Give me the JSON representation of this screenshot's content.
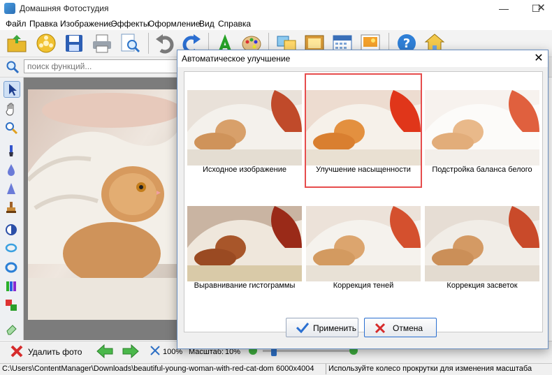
{
  "window": {
    "title": "Домашняя Фотостудия"
  },
  "menu": [
    "Файл",
    "Правка",
    "Изображение",
    "Эффекты",
    "Оформление",
    "Вид",
    "Справка"
  ],
  "search": {
    "placeholder": "поиск функций..."
  },
  "bottom": {
    "delete_label": "Удалить фото",
    "zoom_label": "100%",
    "scale_label": "Масштаб:",
    "scale_value": "10%",
    "zoom_level": 0.1
  },
  "status": {
    "path": "C:\\Users\\ContentManager\\Downloads\\beautiful-young-woman-with-red-cat-domestic-ca",
    "dims": "6000x4004",
    "hint": "Используйте колесо прокрутки для изменения масштаба"
  },
  "dialog": {
    "title": "Автоматическое улучшение",
    "options": [
      {
        "label": "Исходное изображение",
        "selected": false
      },
      {
        "label": "Улучшение насыщенности",
        "selected": true
      },
      {
        "label": "Подстройка баланса белого",
        "selected": false
      },
      {
        "label": "Выравнивание гистограммы",
        "selected": false
      },
      {
        "label": "Коррекция теней",
        "selected": false
      },
      {
        "label": "Коррекция засветок",
        "selected": false
      }
    ],
    "apply_label": "Применить",
    "cancel_label": "Отмена"
  },
  "colors": {
    "accent": "#e64d4d",
    "dialog_border": "#6b8fbf",
    "check_blue": "#2a6fd1",
    "cross_red": "#d62b2b"
  }
}
